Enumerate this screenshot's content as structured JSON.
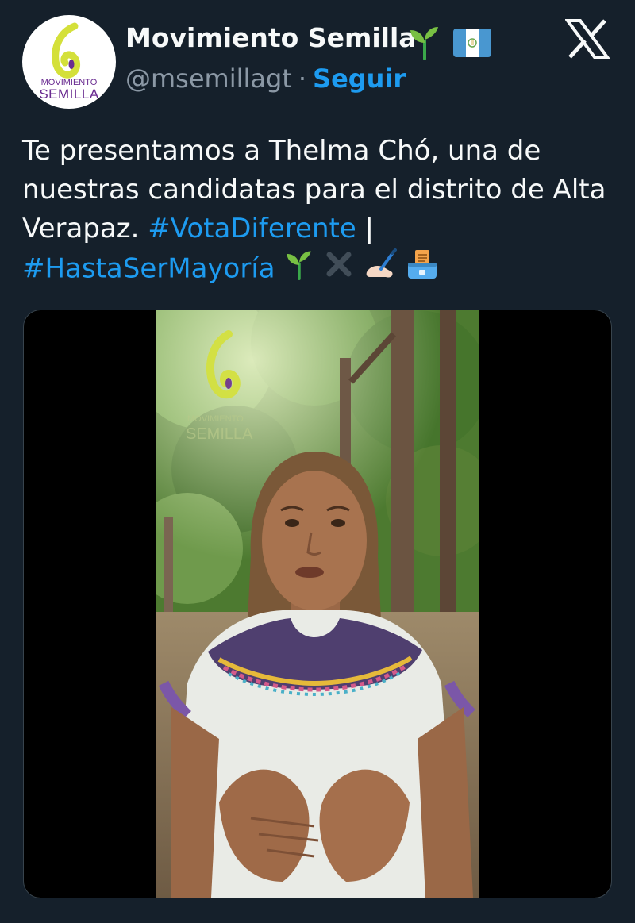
{
  "header": {
    "display_name": "Movimiento Semilla",
    "handle": "@msemillagt",
    "separator": "·",
    "follow_label": "Seguir",
    "avatar_logo_text_line1": "MOVIMIENTO",
    "avatar_logo_text_line2": "SEMILLA",
    "name_icons": [
      "seedling-icon",
      "guatemala-flag-icon"
    ],
    "platform_icon": "x-logo-icon"
  },
  "tweet": {
    "text_line1": "Te presentamos a Thelma Chó, una de",
    "text_line2": "nuestras candidatas para el distrito de Alta",
    "text_line3_prefix": "Verapaz.",
    "hashtag1": "#VotaDiferente",
    "text_line3_suffix": "|",
    "hashtag2": "#HastaSerMayoría",
    "trailing_emojis": [
      "seedling-icon",
      "cross-mark-icon",
      "writing-hand-icon",
      "ballot-box-icon"
    ]
  },
  "media": {
    "type": "video",
    "watermark_text_line1": "MOVIMIENTO",
    "watermark_text_line2": "SEMILLA"
  },
  "colors": {
    "background": "#15202b",
    "text": "#f7f9f9",
    "secondary": "#8b98a5",
    "accent": "#1d9bf0",
    "brand_yellow": "#d4e03a",
    "brand_purple": "#6a2c91"
  }
}
